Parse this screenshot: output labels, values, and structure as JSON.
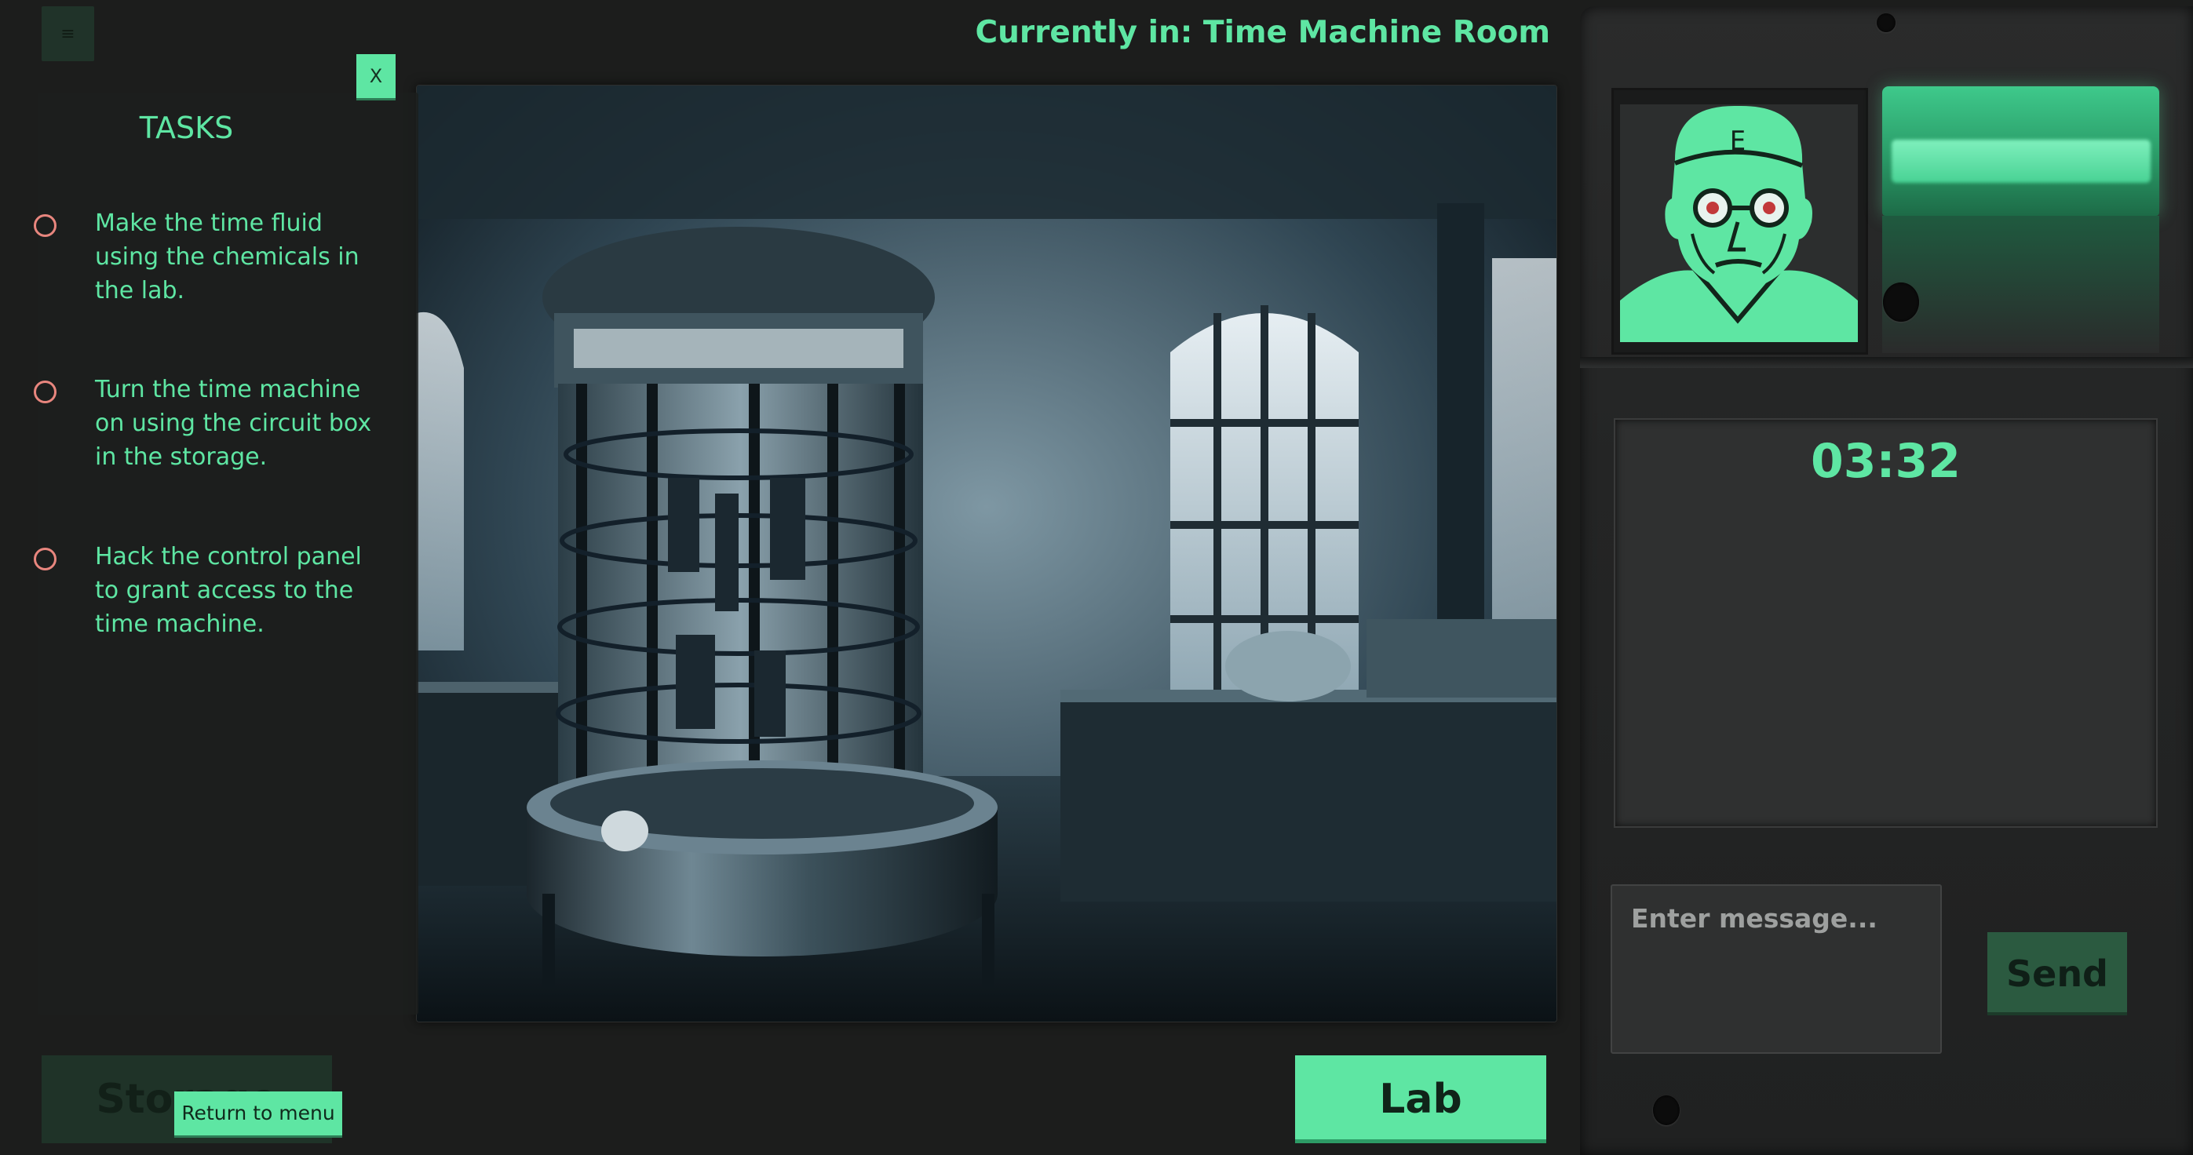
{
  "menu": {
    "icon": "hamburger-menu-icon"
  },
  "header": {
    "location": "Currently in: Time Machine Room"
  },
  "tasks": {
    "title": "TASKS",
    "close_label": "X",
    "items": [
      {
        "text": "Make the time fluid using the chemicals in the lab."
      },
      {
        "text": "Turn the time machine on using the circuit box in the storage."
      },
      {
        "text": "Hack the control panel to grant access to the time machine."
      }
    ]
  },
  "nav": {
    "left_label": "Storage",
    "return_label": "Return to menu",
    "right_label": "Lab"
  },
  "device": {
    "timer": "03:32",
    "message_placeholder": "Enter message...",
    "send_label": "Send"
  },
  "colors": {
    "accent": "#5ee6a3",
    "task_circle": "#e8867e",
    "background": "#1c1d1c"
  }
}
